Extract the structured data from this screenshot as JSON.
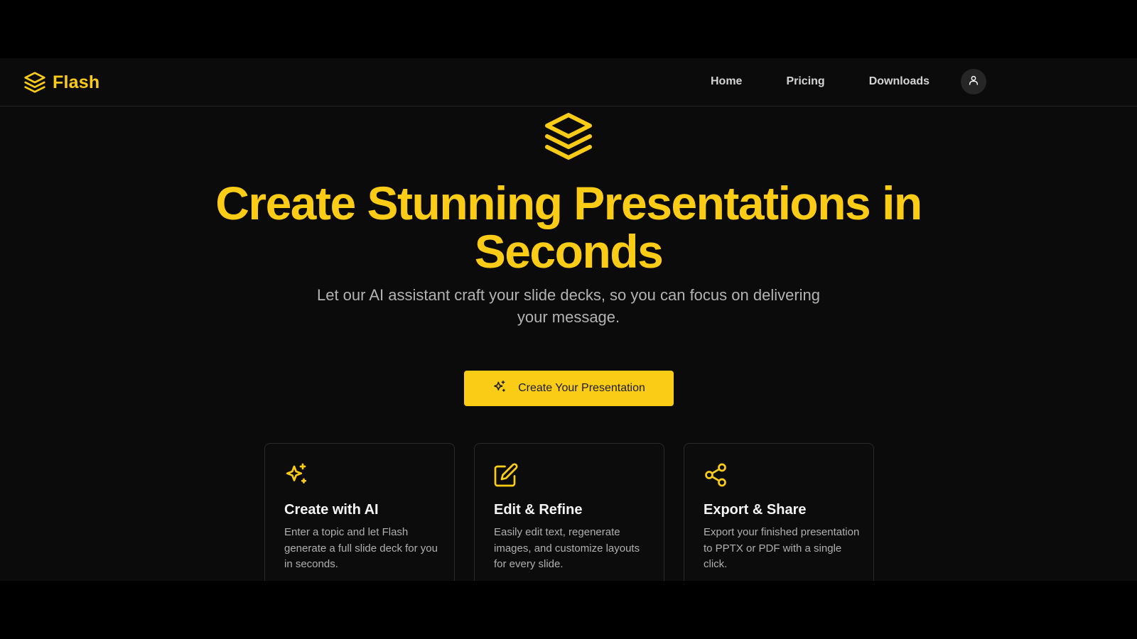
{
  "brand": {
    "name": "Flash",
    "logo_icon": "layers-icon"
  },
  "nav": {
    "links": [
      "Home",
      "Pricing",
      "Downloads"
    ],
    "profile_icon": "user-icon"
  },
  "hero": {
    "icon": "layers-icon",
    "title": "Create Stunning Presentations in Seconds",
    "subtitle": "Let our AI assistant craft your slide decks, so you can focus on delivering your message.",
    "cta_label": "Create Your Presentation",
    "cta_icon": "sparkles-icon"
  },
  "features": [
    {
      "icon": "sparkles-icon",
      "title": "Create with AI",
      "description": "Enter a topic and let Flash generate a full slide deck for you in seconds."
    },
    {
      "icon": "edit-icon",
      "title": "Edit & Refine",
      "description": "Easily edit text, regenerate images, and customize layouts for every slide."
    },
    {
      "icon": "share-icon",
      "title": "Export & Share",
      "description": "Export your finished presentation to PPTX or PDF with a single click."
    }
  ],
  "colors": {
    "accent": "#facc15",
    "background": "#0b0b0b",
    "letterbox": "#000000"
  }
}
